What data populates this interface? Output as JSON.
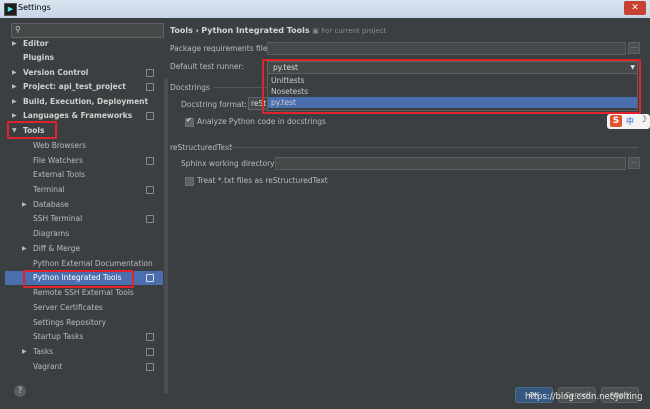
{
  "window": {
    "title": "Settings",
    "close_label": "✕"
  },
  "search": {
    "placeholder": ""
  },
  "tree": {
    "editor": "Editor",
    "plugins": "Plugins",
    "version_control": "Version Control",
    "project": "Project: api_test_project",
    "build": "Build, Execution, Deployment",
    "languages": "Languages & Frameworks",
    "tools": "Tools",
    "web_browsers": "Web Browsers",
    "file_watchers": "File Watchers",
    "external_tools": "External Tools",
    "terminal": "Terminal",
    "database": "Database",
    "ssh_terminal": "SSH Terminal",
    "diagrams": "Diagrams",
    "diff_merge": "Diff & Merge",
    "python_ext_docs": "Python External Documentation",
    "python_integrated_tools": "Python Integrated Tools",
    "remote_ssh": "Remote SSH External Tools",
    "server_certs": "Server Certificates",
    "settings_repo": "Settings Repository",
    "startup_tasks": "Startup Tasks",
    "tasks": "Tasks",
    "vagrant": "Vagrant"
  },
  "breadcrumb": {
    "parent": "Tools",
    "separator": "›",
    "current": "Python Integrated Tools",
    "scope": "For current project"
  },
  "form": {
    "package_req_label": "Package requirements file:",
    "default_runner_label": "Default test runner:",
    "runner_value": "py.test",
    "runner_options": [
      "Unittests",
      "Nosetests",
      "py.test"
    ],
    "docstrings_section": "Docstrings",
    "docstring_format_label": "Docstring format:",
    "docstring_format_value": "reSt",
    "analyze_label": "Analyze Python code in docstrings",
    "rest_section": "reStructuredText",
    "sphinx_label": "Sphinx working directory:",
    "treat_txt_label": "Treat *.txt files as reStructuredText"
  },
  "ime": {
    "s": "S",
    "zh": "中",
    "moon": "☽"
  },
  "footer": {
    "help": "?",
    "ok": "OK",
    "cancel": "Cancel",
    "apply": "Apply"
  },
  "watermark": "https://blog.csdn.net/Jolting",
  "colors": {
    "selection": "#4b6eaf",
    "highlight": "#e0242b",
    "background": "#3c3f41"
  }
}
